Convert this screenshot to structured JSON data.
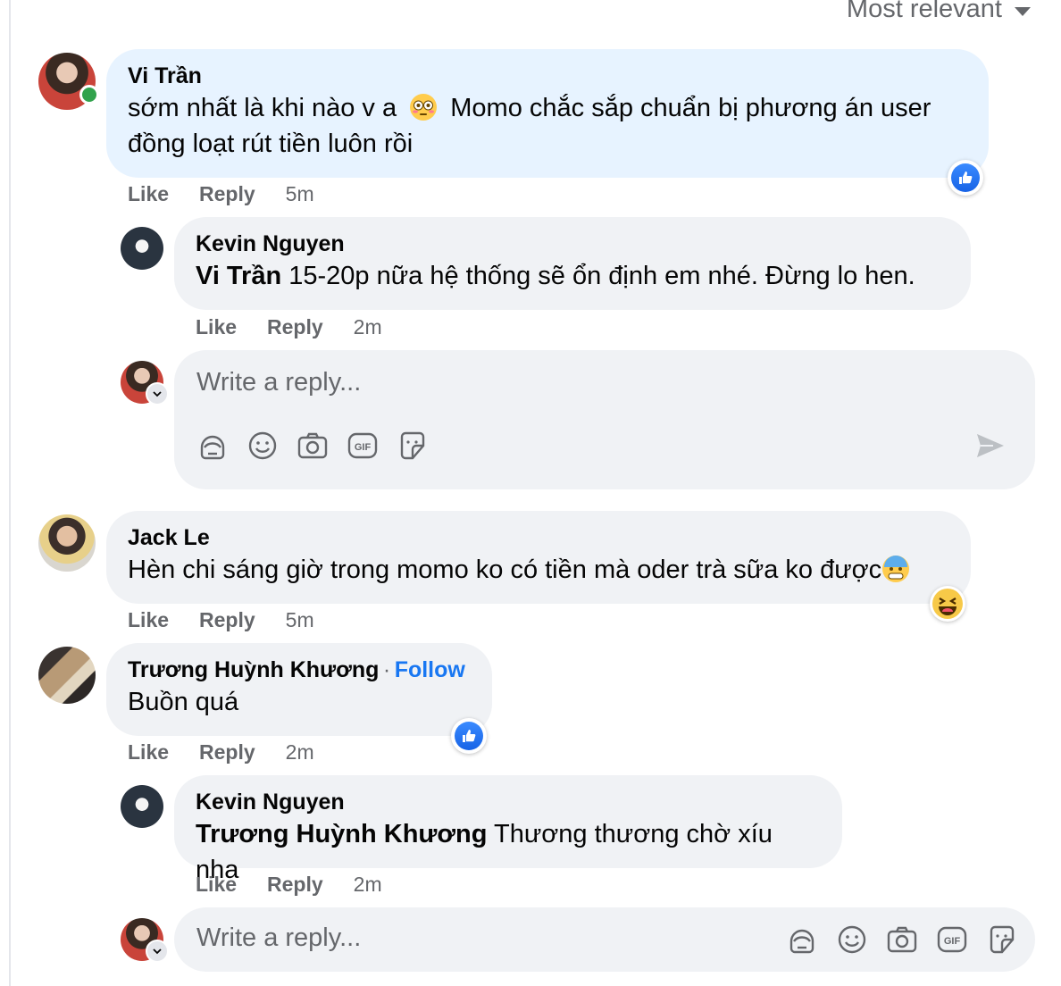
{
  "sort": {
    "label": "Most relevant"
  },
  "comments": [
    {
      "author": "Vi Trần",
      "text_a": "sớm nhất là khi nào v a",
      "text_b": "Momo chắc sắp chuẩn bị phương án user",
      "text_c": "đồng loạt rút tiền luôn rồi",
      "like_label": "Like",
      "reply_label": "Reply",
      "time": "5m"
    },
    {
      "author": "Kevin Nguyen",
      "mention": "Vi Trần",
      "text": " 15-20p nữa hệ thống sẽ ổn định em nhé. Đừng lo hen.",
      "like_label": "Like",
      "reply_label": "Reply",
      "time": "2m"
    },
    {
      "author": "Jack Le",
      "text": "Hèn chi sáng giờ trong momo ko có tiền mà oder trà sữa ko được",
      "like_label": "Like",
      "reply_label": "Reply",
      "time": "5m"
    },
    {
      "author": "Trương Huỳnh Khương",
      "dot": "·",
      "follow": "Follow",
      "text": "Buồn quá",
      "like_label": "Like",
      "reply_label": "Reply",
      "time": "2m"
    },
    {
      "author": "Kevin Nguyen",
      "mention": "Trương Huỳnh Khương",
      "text": " Thương thương chờ xíu nha",
      "like_label": "Like",
      "reply_label": "Reply",
      "time": "2m"
    }
  ],
  "reply_inputs": [
    {
      "placeholder": "Write a reply..."
    },
    {
      "placeholder": "Write a reply..."
    }
  ],
  "colors": {
    "accent": "#1877f2",
    "bubble": "#f0f2f5",
    "highlight": "#e7f3ff",
    "online": "#31a24c"
  },
  "icons": [
    "avatar-sticker-icon",
    "emoji-icon",
    "camera-icon",
    "gif-icon",
    "sticker-icon",
    "send-icon",
    "like-reaction-icon",
    "haha-reaction-icon",
    "flushed-emoji-icon",
    "cold-sweat-emoji-icon"
  ]
}
